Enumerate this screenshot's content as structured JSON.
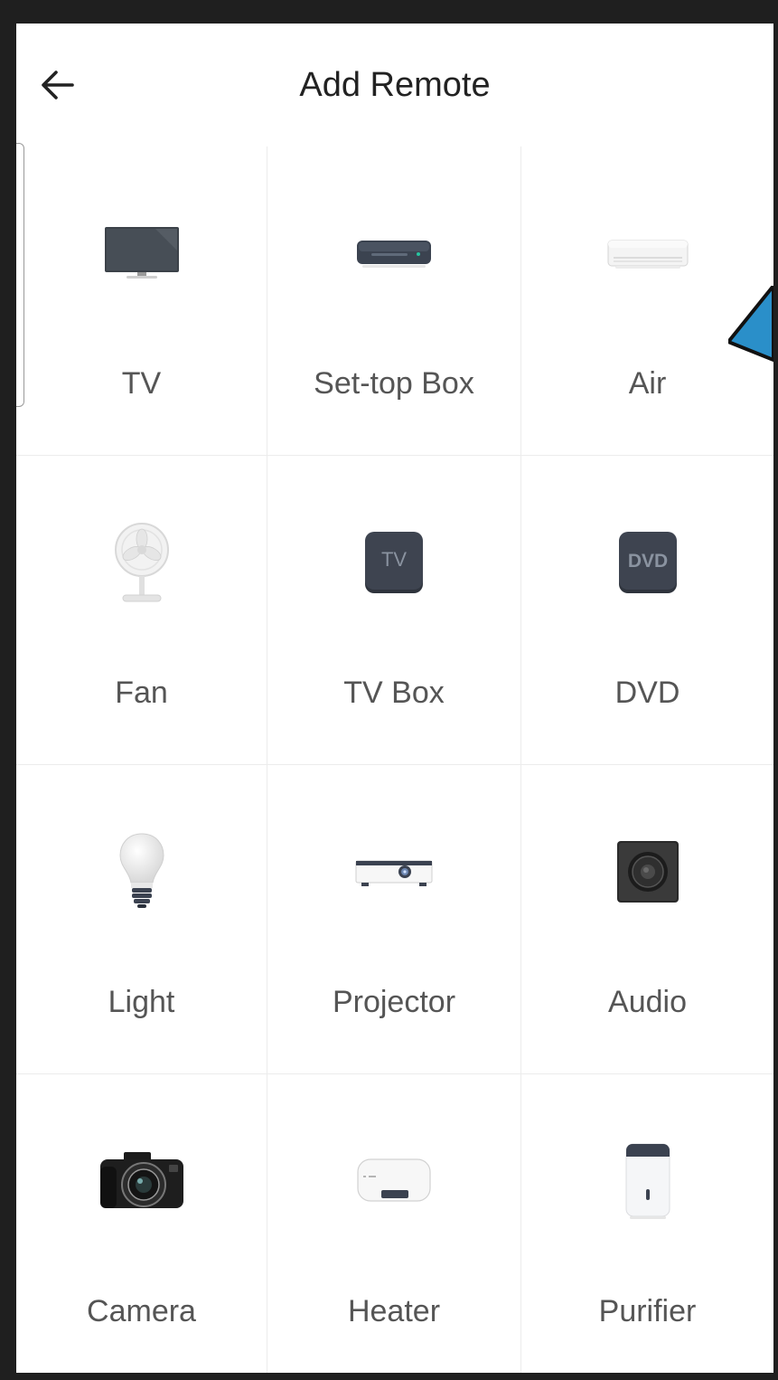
{
  "header": {
    "title": "Add Remote",
    "back_icon": "arrow-left-icon"
  },
  "devices": [
    {
      "label": "TV",
      "icon": "tv-icon"
    },
    {
      "label": "Set-top Box",
      "icon": "set-top-box-icon"
    },
    {
      "label": "Air",
      "icon": "air-conditioner-icon"
    },
    {
      "label": "Fan",
      "icon": "fan-icon"
    },
    {
      "label": "TV Box",
      "icon": "tv-box-icon",
      "badge": "TV"
    },
    {
      "label": "DVD",
      "icon": "dvd-icon",
      "badge": "DVD"
    },
    {
      "label": "Light",
      "icon": "light-bulb-icon"
    },
    {
      "label": "Projector",
      "icon": "projector-icon"
    },
    {
      "label": "Audio",
      "icon": "speaker-icon"
    },
    {
      "label": "Camera",
      "icon": "camera-icon"
    },
    {
      "label": "Heater",
      "icon": "water-heater-icon"
    },
    {
      "label": "Purifier",
      "icon": "air-purifier-icon"
    }
  ],
  "colors": {
    "background": "#ffffff",
    "title": "#222222",
    "label": "#555555",
    "divider": "#ececec",
    "accent_pointer": "#2a8fc9"
  }
}
